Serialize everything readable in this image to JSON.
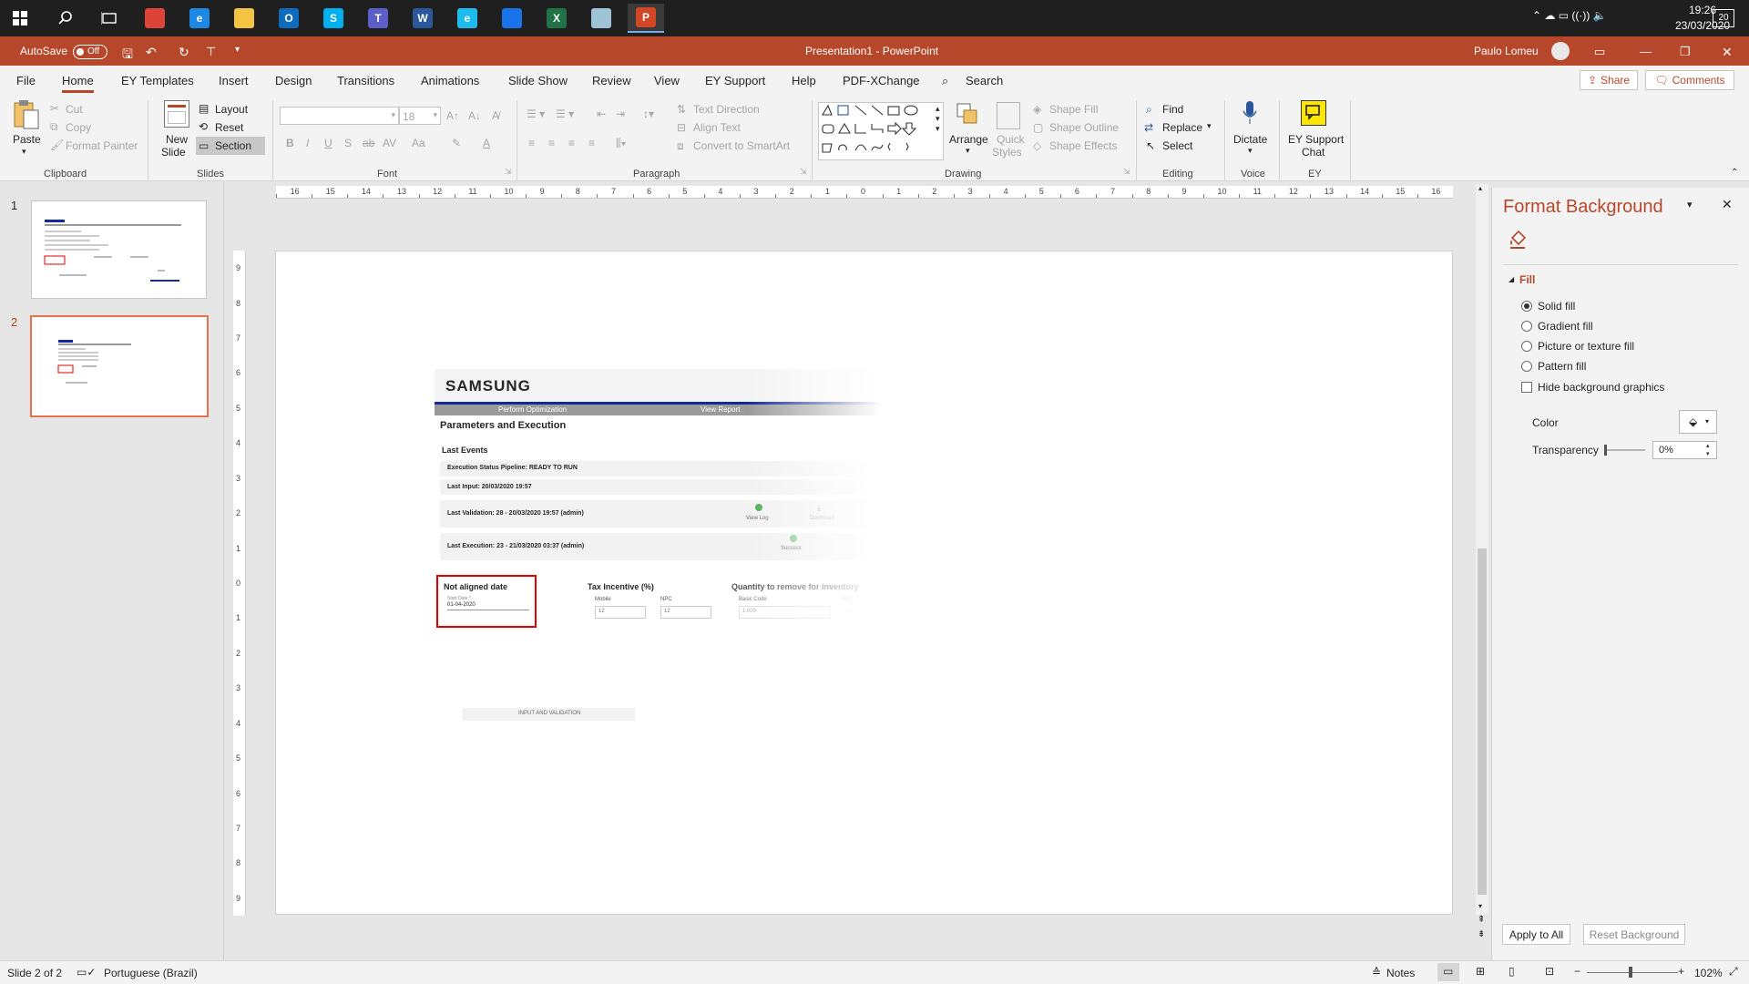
{
  "taskbar": {
    "time": "19:26",
    "date": "23/03/2020",
    "notification_count": "20",
    "apps": [
      {
        "name": "chrome",
        "glyph": "",
        "color": "#db4437"
      },
      {
        "name": "edge",
        "glyph": "e",
        "color": "#1e88e5"
      },
      {
        "name": "explorer",
        "glyph": "",
        "color": "#f4c542"
      },
      {
        "name": "outlook",
        "glyph": "O",
        "color": "#0f6cbd"
      },
      {
        "name": "skype",
        "glyph": "S",
        "color": "#00aff0"
      },
      {
        "name": "teams",
        "glyph": "T",
        "color": "#5b5fc7"
      },
      {
        "name": "word",
        "glyph": "W",
        "color": "#2b579a"
      },
      {
        "name": "ie",
        "glyph": "e",
        "color": "#1ebbee"
      },
      {
        "name": "app-blue",
        "glyph": "",
        "color": "#1a73e8"
      },
      {
        "name": "excel",
        "glyph": "X",
        "color": "#217346"
      },
      {
        "name": "app-gray",
        "glyph": "",
        "color": "#9ec3d6"
      },
      {
        "name": "powerpoint",
        "glyph": "P",
        "color": "#d24726"
      }
    ]
  },
  "titlebar": {
    "autosave": "AutoSave",
    "autosave_state": "Off",
    "title": "Presentation1  -  PowerPoint",
    "user": "Paulo Lomeu"
  },
  "tabs": [
    "File",
    "Home",
    "EY Templates",
    "Insert",
    "Design",
    "Transitions",
    "Animations",
    "Slide Show",
    "Review",
    "View",
    "EY Support",
    "Help",
    "PDF-XChange"
  ],
  "search": "Search",
  "share": "Share",
  "comments": "Comments",
  "ribbon": {
    "paste": "Paste",
    "cut": "Cut",
    "copy": "Copy",
    "format_painter": "Format Painter",
    "clipboard": "Clipboard",
    "new_slide_1": "New",
    "new_slide_2": "Slide",
    "layout": "Layout",
    "reset": "Reset",
    "section": "Section",
    "slides": "Slides",
    "font_size": "18",
    "font": "Font",
    "text_direction": "Text Direction",
    "align_text": "Align Text",
    "convert_smartart": "Convert to SmartArt",
    "paragraph": "Paragraph",
    "arrange": "Arrange",
    "quick_styles_1": "Quick",
    "quick_styles_2": "Styles",
    "shape_fill": "Shape Fill",
    "shape_outline": "Shape Outline",
    "shape_effects": "Shape Effects",
    "drawing": "Drawing",
    "find": "Find",
    "replace": "Replace",
    "select": "Select",
    "editing": "Editing",
    "dictate": "Dictate",
    "voice": "Voice",
    "ey_support_1": "EY Support",
    "ey_support_2": "Chat",
    "ey": "EY"
  },
  "thumbnails": [
    "1",
    "2"
  ],
  "selected_slide": 2,
  "ruler_labels": [
    "16",
    "15",
    "14",
    "13",
    "12",
    "11",
    "10",
    "9",
    "8",
    "7",
    "6",
    "5",
    "4",
    "3",
    "2",
    "1",
    "0",
    "1",
    "2",
    "3",
    "4",
    "5",
    "6",
    "7",
    "8",
    "9",
    "10",
    "11",
    "12",
    "13",
    "14",
    "15",
    "16"
  ],
  "vruler_labels": [
    "9",
    "8",
    "7",
    "6",
    "5",
    "4",
    "3",
    "2",
    "1",
    "0",
    "1",
    "2",
    "3",
    "4",
    "5",
    "6",
    "7",
    "8",
    "9"
  ],
  "slide_content": {
    "brand": "SAMSUNG",
    "nav_perform": "Perform Optimization",
    "nav_report": "View Report",
    "section_title": "Parameters and Execution",
    "last_events": "Last Events",
    "status_pipeline": "Execution Status Pipeline: READY TO RUN",
    "last_input": "Last Input: 20/03/2020 19:57",
    "last_validation": "Last Validation: 28 - 20/03/2020 19:57 (admin)",
    "view_log": "View Log",
    "download": "Download",
    "last_execution": "Last Execution: 23 - 21/03/2020 03:37 (admin)",
    "success": "Success",
    "not_aligned": "Not aligned date",
    "start_date_label": "Start Date *",
    "start_date": "01-04-2020",
    "tax_incentive": "Tax Incentive (%)",
    "mobile": "Mobile",
    "npc": "NPC",
    "mobile_val": "12",
    "npc_val": "12",
    "quantity": "Quantity to remove for inventory",
    "basic_code": "Basic Code",
    "basic_val": "1.000",
    "skd": "SKD",
    "skd_val": "500",
    "input_validation": "INPUT AND VALIDATION"
  },
  "pane": {
    "title": "Format Background",
    "fill": "Fill",
    "solid": "Solid fill",
    "gradient": "Gradient fill",
    "picture": "Picture or texture fill",
    "pattern": "Pattern fill",
    "hide_bg": "Hide background graphics",
    "color": "Color",
    "transparency": "Transparency",
    "transparency_val": "0%",
    "apply_all": "Apply to All",
    "reset_bg": "Reset Background",
    "selected_fill": "solid"
  },
  "status": {
    "slide_info": "Slide 2 of 2",
    "language": "Portuguese (Brazil)",
    "notes": "Notes",
    "zoom": "102%"
  },
  "colors": {
    "accent": "#b7472a",
    "samsung_blue": "#1428a0",
    "highlight_red": "#e00000"
  }
}
